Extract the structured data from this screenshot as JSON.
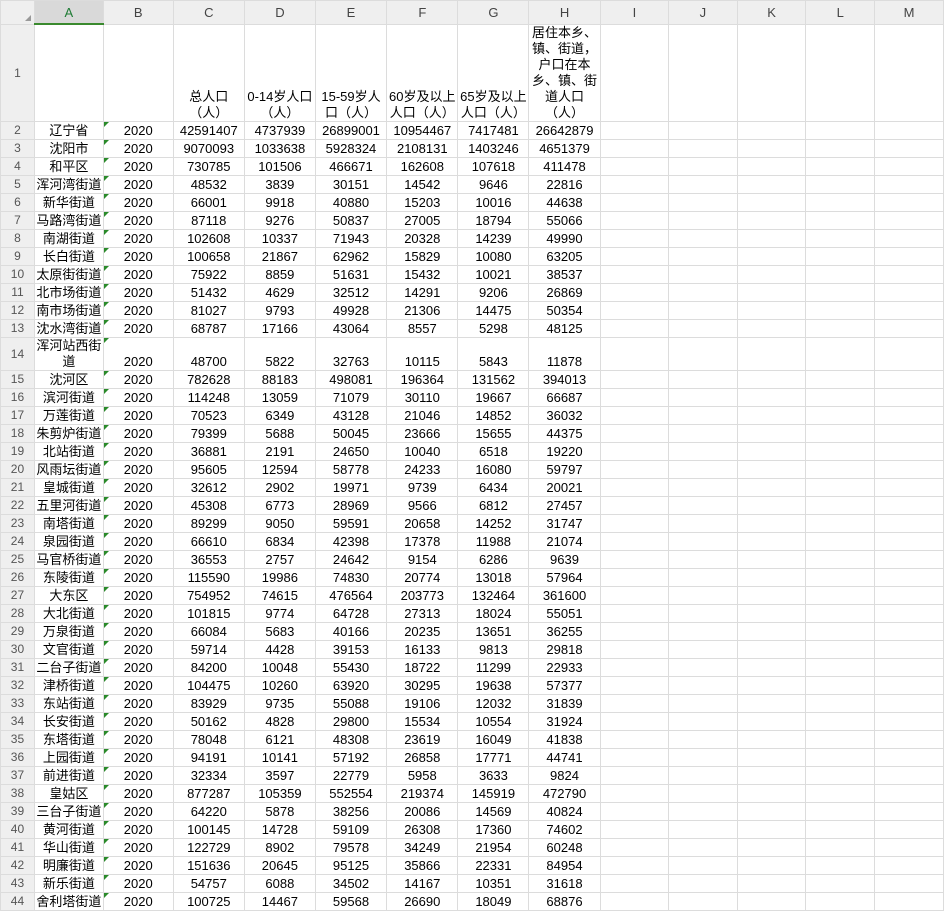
{
  "columns": [
    "A",
    "B",
    "C",
    "D",
    "E",
    "F",
    "G",
    "H",
    "I",
    "J",
    "K",
    "L",
    "M"
  ],
  "selected_column": "A",
  "header_row": [
    "",
    "",
    "总人口（人）",
    "0-14岁人口（人）",
    "15-59岁人口（人）",
    "60岁及以上人口（人）",
    "65岁及以上人口（人）",
    "居住本乡、镇、街道，户口在本乡、镇、街道人口（人）"
  ],
  "rows": [
    [
      "辽宁省",
      "2020",
      "42591407",
      "4737939",
      "26899001",
      "10954467",
      "7417481",
      "26642879"
    ],
    [
      "沈阳市",
      "2020",
      "9070093",
      "1033638",
      "5928324",
      "2108131",
      "1403246",
      "4651379"
    ],
    [
      "和平区",
      "2020",
      "730785",
      "101506",
      "466671",
      "162608",
      "107618",
      "411478"
    ],
    [
      "浑河湾街道",
      "2020",
      "48532",
      "3839",
      "30151",
      "14542",
      "9646",
      "22816"
    ],
    [
      "新华街道",
      "2020",
      "66001",
      "9918",
      "40880",
      "15203",
      "10016",
      "44638"
    ],
    [
      "马路湾街道",
      "2020",
      "87118",
      "9276",
      "50837",
      "27005",
      "18794",
      "55066"
    ],
    [
      "南湖街道",
      "2020",
      "102608",
      "10337",
      "71943",
      "20328",
      "14239",
      "49990"
    ],
    [
      "长白街道",
      "2020",
      "100658",
      "21867",
      "62962",
      "15829",
      "10080",
      "63205"
    ],
    [
      "太原街街道",
      "2020",
      "75922",
      "8859",
      "51631",
      "15432",
      "10021",
      "38537"
    ],
    [
      "北市场街道",
      "2020",
      "51432",
      "4629",
      "32512",
      "14291",
      "9206",
      "26869"
    ],
    [
      "南市场街道",
      "2020",
      "81027",
      "9793",
      "49928",
      "21306",
      "14475",
      "50354"
    ],
    [
      "沈水湾街道",
      "2020",
      "68787",
      "17166",
      "43064",
      "8557",
      "5298",
      "48125"
    ],
    [
      "浑河站西街道",
      "2020",
      "48700",
      "5822",
      "32763",
      "10115",
      "5843",
      "11878"
    ],
    [
      "沈河区",
      "2020",
      "782628",
      "88183",
      "498081",
      "196364",
      "131562",
      "394013"
    ],
    [
      "滨河街道",
      "2020",
      "114248",
      "13059",
      "71079",
      "30110",
      "19667",
      "66687"
    ],
    [
      "万莲街道",
      "2020",
      "70523",
      "6349",
      "43128",
      "21046",
      "14852",
      "36032"
    ],
    [
      "朱剪炉街道",
      "2020",
      "79399",
      "5688",
      "50045",
      "23666",
      "15655",
      "44375"
    ],
    [
      "北站街道",
      "2020",
      "36881",
      "2191",
      "24650",
      "10040",
      "6518",
      "19220"
    ],
    [
      "风雨坛街道",
      "2020",
      "95605",
      "12594",
      "58778",
      "24233",
      "16080",
      "59797"
    ],
    [
      "皇城街道",
      "2020",
      "32612",
      "2902",
      "19971",
      "9739",
      "6434",
      "20021"
    ],
    [
      "五里河街道",
      "2020",
      "45308",
      "6773",
      "28969",
      "9566",
      "6812",
      "27457"
    ],
    [
      "南塔街道",
      "2020",
      "89299",
      "9050",
      "59591",
      "20658",
      "14252",
      "31747"
    ],
    [
      "泉园街道",
      "2020",
      "66610",
      "6834",
      "42398",
      "17378",
      "11988",
      "21074"
    ],
    [
      "马官桥街道",
      "2020",
      "36553",
      "2757",
      "24642",
      "9154",
      "6286",
      "9639"
    ],
    [
      "东陵街道",
      "2020",
      "115590",
      "19986",
      "74830",
      "20774",
      "13018",
      "57964"
    ],
    [
      "大东区",
      "2020",
      "754952",
      "74615",
      "476564",
      "203773",
      "132464",
      "361600"
    ],
    [
      "大北街道",
      "2020",
      "101815",
      "9774",
      "64728",
      "27313",
      "18024",
      "55051"
    ],
    [
      "万泉街道",
      "2020",
      "66084",
      "5683",
      "40166",
      "20235",
      "13651",
      "36255"
    ],
    [
      "文官街道",
      "2020",
      "59714",
      "4428",
      "39153",
      "16133",
      "9813",
      "29818"
    ],
    [
      "二台子街道",
      "2020",
      "84200",
      "10048",
      "55430",
      "18722",
      "11299",
      "22933"
    ],
    [
      "津桥街道",
      "2020",
      "104475",
      "10260",
      "63920",
      "30295",
      "19638",
      "57377"
    ],
    [
      "东站街道",
      "2020",
      "83929",
      "9735",
      "55088",
      "19106",
      "12032",
      "31839"
    ],
    [
      "长安街道",
      "2020",
      "50162",
      "4828",
      "29800",
      "15534",
      "10554",
      "31924"
    ],
    [
      "东塔街道",
      "2020",
      "78048",
      "6121",
      "48308",
      "23619",
      "16049",
      "41838"
    ],
    [
      "上园街道",
      "2020",
      "94191",
      "10141",
      "57192",
      "26858",
      "17771",
      "44741"
    ],
    [
      "前进街道",
      "2020",
      "32334",
      "3597",
      "22779",
      "5958",
      "3633",
      "9824"
    ],
    [
      "皇姑区",
      "2020",
      "877287",
      "105359",
      "552554",
      "219374",
      "145919",
      "472790"
    ],
    [
      "三台子街道",
      "2020",
      "64220",
      "5878",
      "38256",
      "20086",
      "14569",
      "40824"
    ],
    [
      "黄河街道",
      "2020",
      "100145",
      "14728",
      "59109",
      "26308",
      "17360",
      "74602"
    ],
    [
      "华山街道",
      "2020",
      "122729",
      "8902",
      "79578",
      "34249",
      "21954",
      "60248"
    ],
    [
      "明廉街道",
      "2020",
      "151636",
      "20645",
      "95125",
      "35866",
      "22331",
      "84954"
    ],
    [
      "新乐街道",
      "2020",
      "54757",
      "6088",
      "34502",
      "14167",
      "10351",
      "31618"
    ],
    [
      "舍利塔街道",
      "2020",
      "100725",
      "14467",
      "59568",
      "26690",
      "18049",
      "68876"
    ]
  ]
}
